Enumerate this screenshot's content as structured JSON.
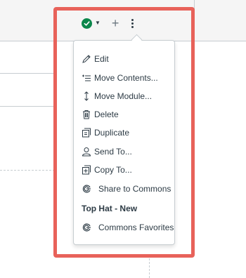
{
  "menu": {
    "items": [
      {
        "label": "Edit",
        "icon": "pencil-icon"
      },
      {
        "label": "Move Contents...",
        "icon": "move-contents-icon"
      },
      {
        "label": "Move Module...",
        "icon": "up-down-arrow-icon"
      },
      {
        "label": "Delete",
        "icon": "trash-icon"
      },
      {
        "label": "Duplicate",
        "icon": "duplicate-icon"
      },
      {
        "label": "Send To...",
        "icon": "user-icon"
      },
      {
        "label": "Copy To...",
        "icon": "copy-to-icon"
      },
      {
        "label": "Share to Commons",
        "icon": "commons-icon"
      },
      {
        "label": "Top Hat - New"
      },
      {
        "label": "Commons Favorites",
        "icon": "commons-icon"
      }
    ]
  },
  "colors": {
    "highlight": "#e8625a",
    "published": "#0b874b",
    "text": "#2d3b45"
  }
}
